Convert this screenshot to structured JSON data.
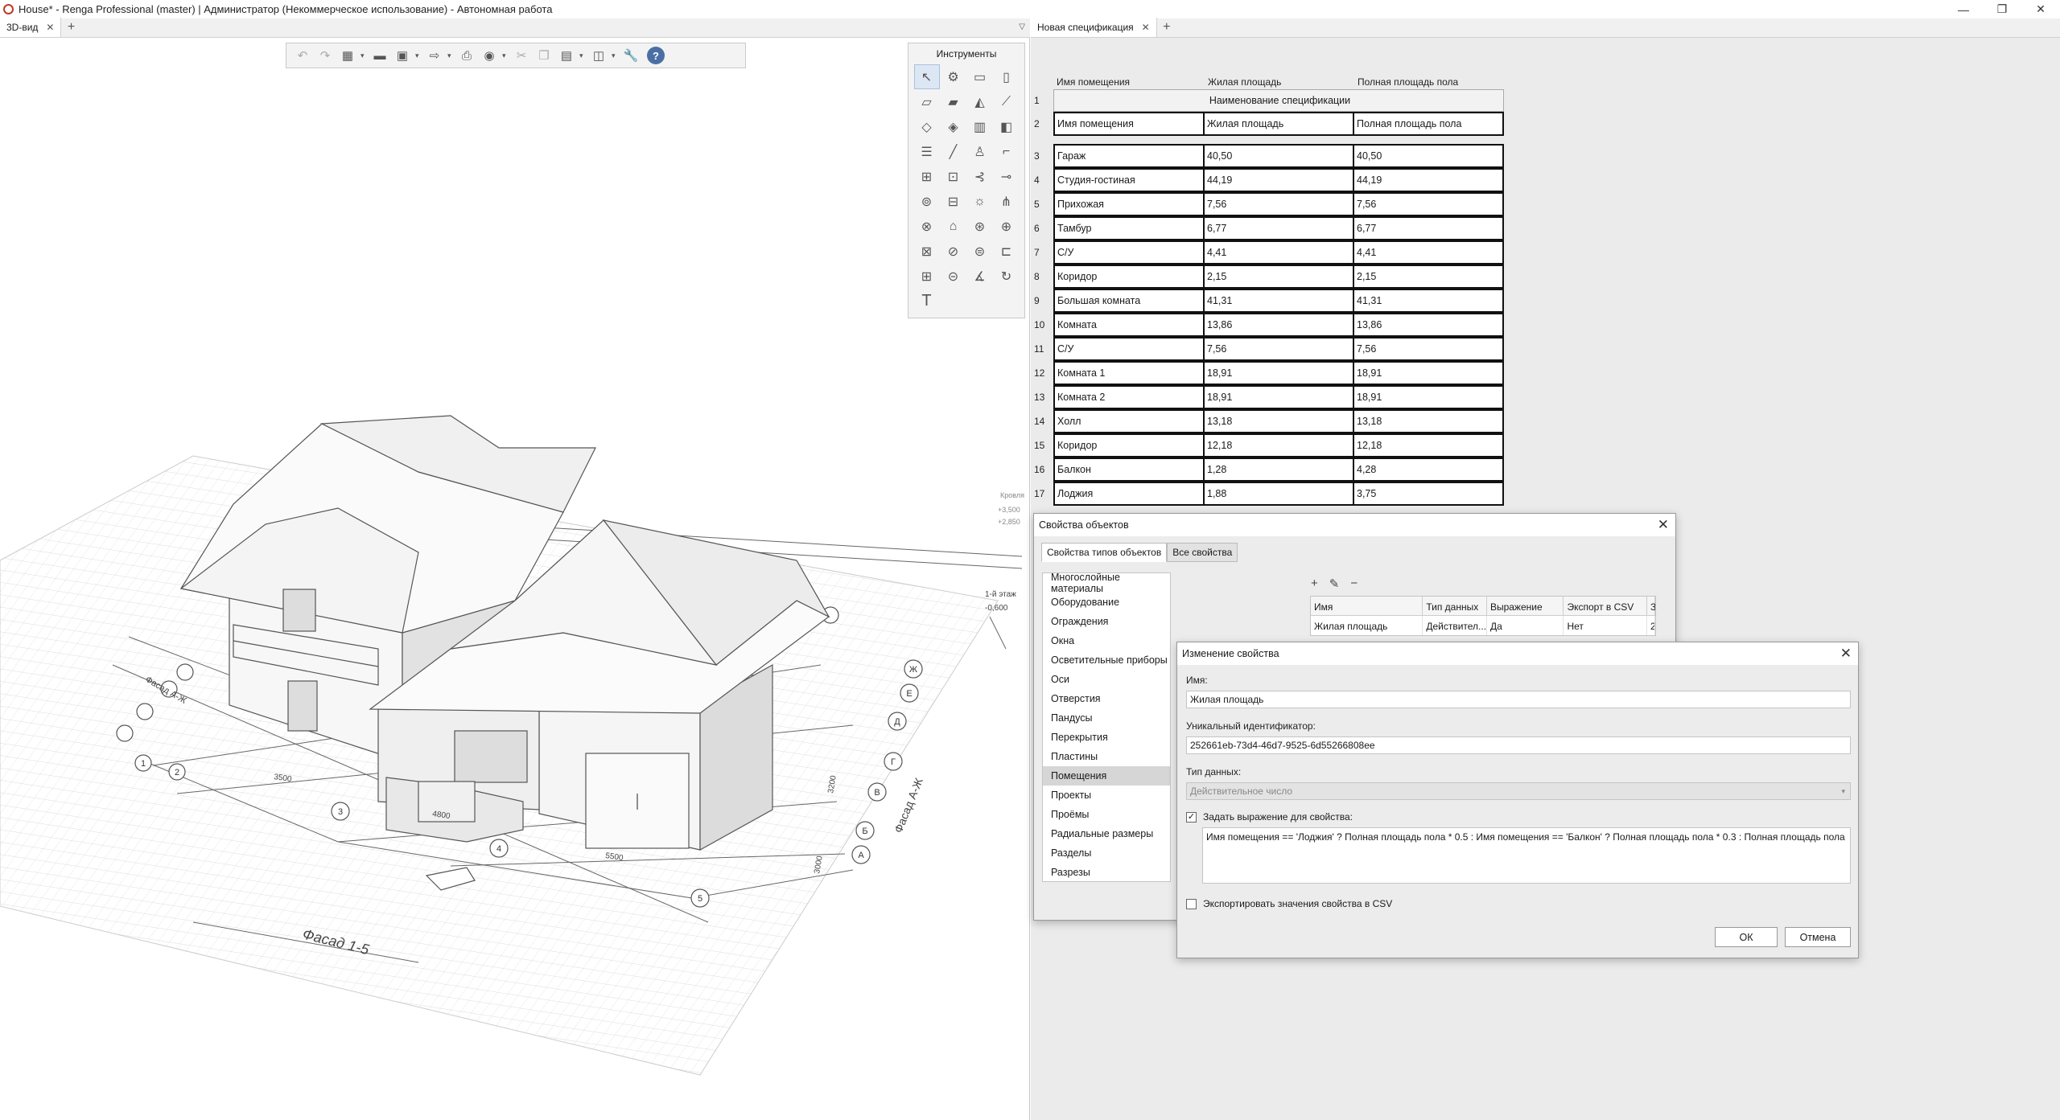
{
  "window": {
    "title": "House* - Renga Professional (master) | Администратор (Некоммерческое использование) - Автономная работа",
    "controls": [
      "—",
      "❐",
      "✕"
    ]
  },
  "left_tabs": [
    {
      "label": "3D-вид"
    }
  ],
  "right_tabs": [
    {
      "label": "Новая спецификация"
    }
  ],
  "tools_panel": {
    "title": "Инструменты"
  },
  "scene": {
    "labels": {
      "facade_bottom": "Фасад 1-5",
      "facade_left": "Фасад А-Ж",
      "facade_right": "Фасад А-Ж",
      "level1": "1-й этаж",
      "level1_elev": "-0,600",
      "roof": "Кровля",
      "roof_elev1": "+3,500",
      "roof_elev2": "+2,850",
      "dim1": "5500",
      "dim2": "4800",
      "dim3": "3500",
      "dim4": "3200",
      "dim5": "3000"
    },
    "axes_numbers": [
      "1",
      "2",
      "3",
      "4",
      "5"
    ],
    "axes_letters": [
      "А",
      "Б",
      "В",
      "Г",
      "Д",
      "Е",
      "Ж"
    ]
  },
  "spec": {
    "columns": [
      "Имя помещения",
      "Жилая площадь",
      "Полная площадь пола"
    ],
    "title_row": {
      "num": "1",
      "text": "Наименование спецификации"
    },
    "header_row": {
      "num": "2",
      "cells": [
        "Имя помещения",
        "Жилая площадь",
        "Полная площадь пола"
      ]
    },
    "rows": [
      {
        "num": "3",
        "name": "Гараж",
        "living": "40,50",
        "total": "40,50"
      },
      {
        "num": "4",
        "name": "Студия-гостиная",
        "living": "44,19",
        "total": "44,19"
      },
      {
        "num": "5",
        "name": "Прихожая",
        "living": "7,56",
        "total": "7,56"
      },
      {
        "num": "6",
        "name": "Тамбур",
        "living": "6,77",
        "total": "6,77"
      },
      {
        "num": "7",
        "name": "С/У",
        "living": "4,41",
        "total": "4,41"
      },
      {
        "num": "8",
        "name": "Коридор",
        "living": "2,15",
        "total": "2,15"
      },
      {
        "num": "9",
        "name": "Большая комната",
        "living": "41,31",
        "total": "41,31"
      },
      {
        "num": "10",
        "name": "Комната",
        "living": "13,86",
        "total": "13,86"
      },
      {
        "num": "11",
        "name": "С/У",
        "living": "7,56",
        "total": "7,56"
      },
      {
        "num": "12",
        "name": "Комната 1",
        "living": "18,91",
        "total": "18,91"
      },
      {
        "num": "13",
        "name": "Комната 2",
        "living": "18,91",
        "total": "18,91"
      },
      {
        "num": "14",
        "name": "Холл",
        "living": "13,18",
        "total": "13,18"
      },
      {
        "num": "15",
        "name": "Коридор",
        "living": "12,18",
        "total": "12,18"
      },
      {
        "num": "16",
        "name": "Балкон",
        "living": "1,28",
        "total": "4,28"
      },
      {
        "num": "17",
        "name": "Лоджия",
        "living": "1,88",
        "total": "3,75"
      }
    ]
  },
  "props_dialog": {
    "title": "Свойства объектов",
    "tabs": [
      "Свойства типов объектов",
      "Все свойства"
    ],
    "types": [
      "Многослойные материалы",
      "Оборудование",
      "Ограждения",
      "Окна",
      "Осветительные приборы",
      "Оси",
      "Отверстия",
      "Пандусы",
      "Перекрытия",
      "Пластины",
      "Помещения",
      "Проекты",
      "Проёмы",
      "Радиальные размеры",
      "Разделы",
      "Разрезы"
    ],
    "selected_type": "Помещения",
    "table_headers": [
      "Имя",
      "Тип данных",
      "Выражение",
      "Экспорт в CSV",
      "З"
    ],
    "table_row": [
      "Жилая площадь",
      "Действител...",
      "Да",
      "Нет",
      "2"
    ]
  },
  "edit_dialog": {
    "title": "Изменение свойства",
    "name_label": "Имя:",
    "name_value": "Жилая площадь",
    "id_label": "Уникальный идентификатор:",
    "id_value": "252661eb-73d4-46d7-9525-6d55266808ee",
    "type_label": "Тип данных:",
    "type_value": "Действительное число",
    "expr_checkbox": "Задать выражение для свойства:",
    "expr_value": "Имя помещения == 'Лоджия' ? Полная площадь пола * 0.5 : Имя помещения == 'Балкон' ? Полная площадь пола * 0.3 : Полная площадь пола",
    "csv_checkbox": "Экспортировать значения свойства в CSV",
    "ok": "ОК",
    "cancel": "Отмена"
  }
}
